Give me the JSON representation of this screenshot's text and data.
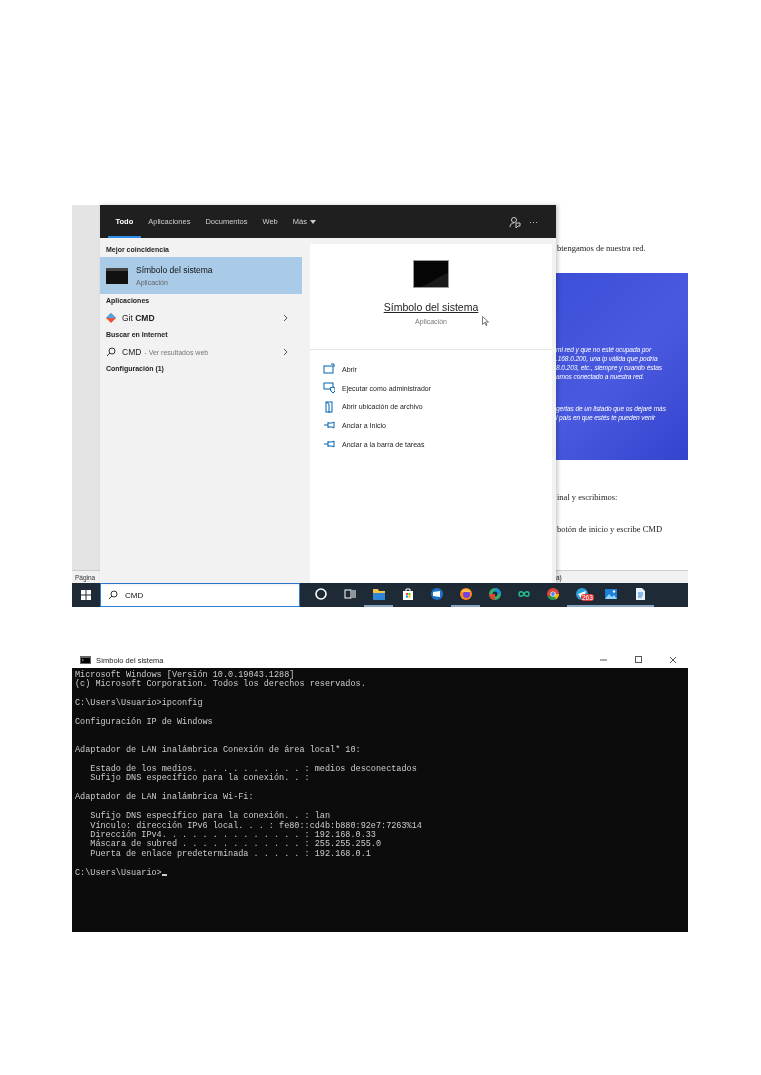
{
  "search_screenshot": {
    "tabs": [
      {
        "label": "Todo",
        "selected": true
      },
      {
        "label": "Aplicaciones",
        "selected": false
      },
      {
        "label": "Documentos",
        "selected": false
      },
      {
        "label": "Web",
        "selected": false
      },
      {
        "label": "Más",
        "selected": false,
        "dropdown": true
      }
    ],
    "more_button": "···",
    "results": [
      {
        "kind": "header",
        "label": "Mejor coincidencia"
      },
      {
        "kind": "best",
        "title": "Símbolo del sistema",
        "subtitle": "Aplicación",
        "selected": true
      },
      {
        "kind": "header",
        "label": "Aplicaciones"
      },
      {
        "kind": "app",
        "label": "Git **CMD**",
        "selected": false
      },
      {
        "kind": "header",
        "label": "Buscar en Internet"
      },
      {
        "kind": "web",
        "label": "CMD",
        "hint": "- Ver resultados web",
        "selected": false
      },
      {
        "kind": "header",
        "label": "Configuración (1)"
      }
    ],
    "preview": {
      "title": "Símbolo del sistema",
      "subtitle": "Aplicación",
      "actions": [
        {
          "kind": "open",
          "label": "Abrir"
        },
        {
          "kind": "admin",
          "label": "Ejecutar como administrador"
        },
        {
          "kind": "location",
          "label": "Abrir ubicación de archivo"
        },
        {
          "kind": "pin",
          "label": "Anclar a Inicio"
        },
        {
          "kind": "pin",
          "label": "Anclar a la barra de tareas"
        }
      ]
    },
    "document": {
      "status_left": "Página",
      "status_right": "a)",
      "blocks": [
        {
          "kind": "text",
          "text": "btengamos de nuestra red."
        },
        {
          "kind": "image",
          "paragraphs": [
            "mi red y que no esté ocupada por\n.168.0.200, una ip válida que podría\n8.0.203, etc., siempre y cuando éstas\namos conectado a nuestra red.",
            "gertas de un listado que os dejaré más\nl país en que estés te pueden venir"
          ]
        },
        {
          "kind": "text",
          "text": "inal y escribimos:"
        },
        {
          "kind": "text",
          "text": "botón de inicio y escribe CMD"
        }
      ]
    },
    "taskbar": {
      "search": {
        "value": "CMD"
      },
      "apps": [
        {
          "kind": "cortana",
          "running": false
        },
        {
          "kind": "taskview",
          "running": false
        },
        {
          "kind": "folder",
          "running": true
        },
        {
          "kind": "store",
          "running": false
        },
        {
          "kind": "mail",
          "running": false
        },
        {
          "kind": "firefox",
          "running": true
        },
        {
          "kind": "edge",
          "running": false
        },
        {
          "kind": "infinity",
          "running": false
        },
        {
          "kind": "chrome",
          "running": false
        },
        {
          "kind": "telegram",
          "running": true,
          "badge": "263"
        },
        {
          "kind": "photos",
          "running": true
        },
        {
          "kind": "document",
          "running": true
        }
      ]
    }
  },
  "console": {
    "title": "Símbolo del sistema",
    "output": "Microsoft Windows [Versión 10.0.19043.1288]\n(c) Microsoft Corporation. Todos los derechos reservados.\n\nC:\\Users\\Usuario>ipconfig\n\nConfiguración IP de Windows\n\n\nAdaptador de LAN inalámbrica Conexión de área local* 10:\n\n   Estado de los medios. . . . . . . . . . . : medios desconectados\n   Sufijo DNS específico para la conexión. . :\n\nAdaptador de LAN inalámbrica Wi-Fi:\n\n   Sufijo DNS específico para la conexión. . : lan\n   Vínculo: dirección IPv6 local. . . : fe80::cd4b:b880:92e7:7263%14\n   Dirección IPv4. . . . . . . . . . . . . . : 192.168.0.33\n   Máscara de subred . . . . . . . . . . . . : 255.255.255.0\n   Puerta de enlace predeterminada . . . . . : 192.168.0.1\n\nC:\\Users\\Usuario>",
    "cursor": true
  }
}
